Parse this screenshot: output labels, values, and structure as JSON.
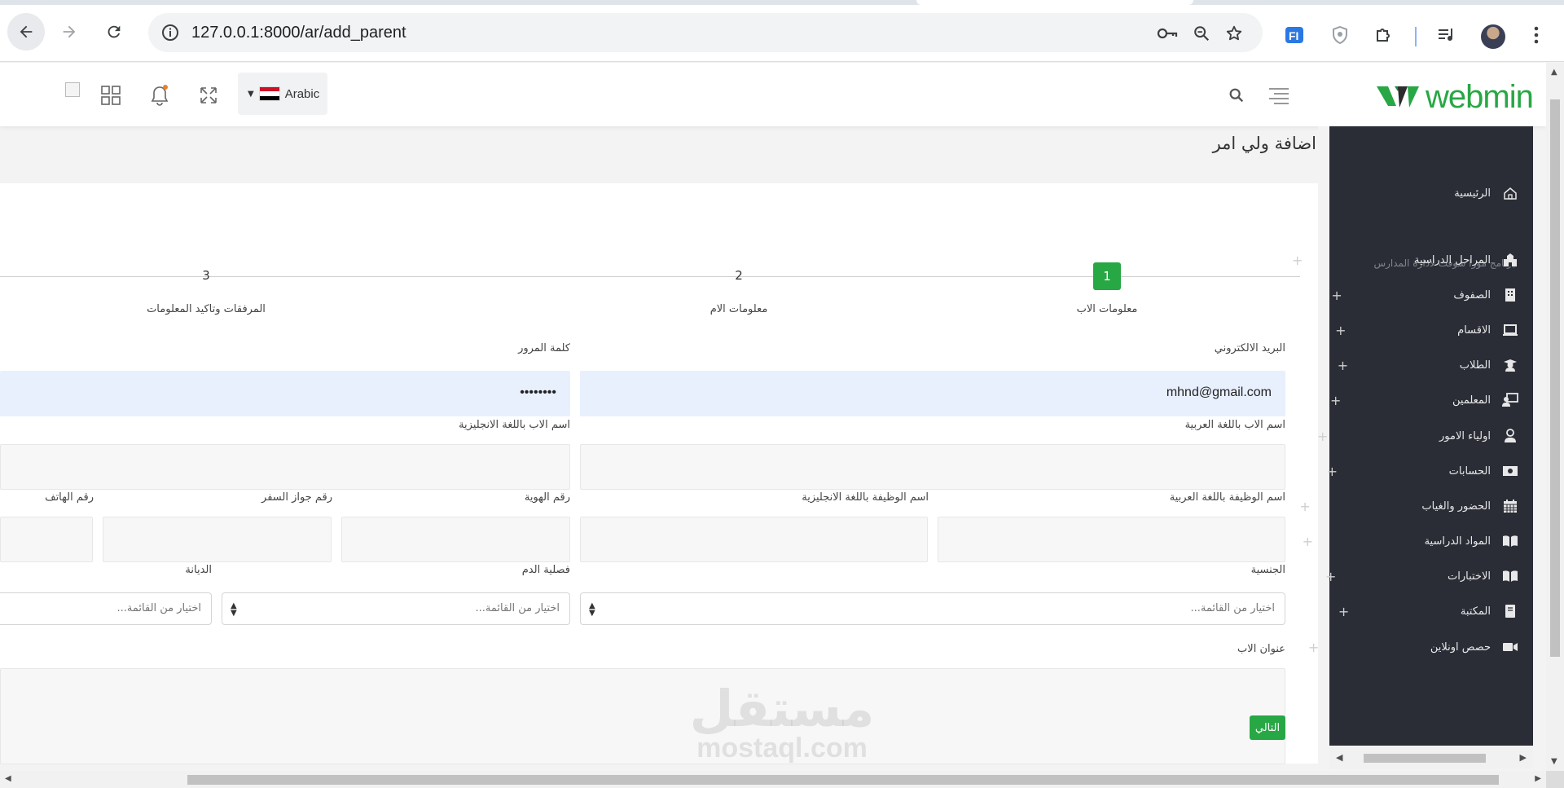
{
  "browser": {
    "url": "127.0.0.1:8000/ar/add_parent"
  },
  "header": {
    "language_label": "Arabic",
    "logo_text": "webmin",
    "flag_colors": [
      "#ce1126",
      "#ffffff",
      "#000000"
    ]
  },
  "sidebar": {
    "caption": "برنامج مورا سوفت لادارة المدارس",
    "items": [
      {
        "label": "الرئيسية",
        "icon": "home-icon"
      },
      {
        "label": "المراحل الدراسية",
        "icon": "school-icon"
      },
      {
        "label": "الصفوف",
        "icon": "building-icon"
      },
      {
        "label": "الاقسام",
        "icon": "laptop-icon"
      },
      {
        "label": "الطلاب",
        "icon": "graduate-icon"
      },
      {
        "label": "المعلمين",
        "icon": "teacher-icon"
      },
      {
        "label": "اولياء الامور",
        "icon": "user-icon"
      },
      {
        "label": "الحسابات",
        "icon": "money-icon"
      },
      {
        "label": "الحضور والغياب",
        "icon": "calendar-icon"
      },
      {
        "label": "المواد الدراسية",
        "icon": "book-open-icon"
      },
      {
        "label": "الاختبارات",
        "icon": "book-open-icon"
      },
      {
        "label": "المكتبة",
        "icon": "book-icon"
      },
      {
        "label": "حصص اونلاين",
        "icon": "video-icon"
      }
    ]
  },
  "page": {
    "title": "اضافة ولي امر"
  },
  "steps": [
    {
      "number": "1",
      "label": "معلومات الاب"
    },
    {
      "number": "2",
      "label": "معلومات الام"
    },
    {
      "number": "3",
      "label": "المرفقات وتاكيد المعلومات"
    }
  ],
  "form": {
    "email_label": "البريد الالكتروني",
    "email_value": "mhnd@gmail.com",
    "password_label": "كلمة المرور",
    "password_value": "••••••••",
    "name_ar_label": "اسم الاب باللغة العربية",
    "name_en_label": "اسم الاب باللغة الانجليزية",
    "job_ar_label": "اسم الوظيفة باللغة العربية",
    "job_en_label": "اسم الوظيفة باللغة الانجليزية",
    "id_label": "رقم الهوية",
    "passport_label": "رقم جواز السفر",
    "phone_label": "رقم الهاتف",
    "nationality_label": "الجنسية",
    "blood_label": "فصلية الدم",
    "religion_label": "الديانة",
    "select_placeholder": "اختيار من القائمة...",
    "address_label": "عنوان الاب",
    "next_label": "التالي"
  },
  "watermark": {
    "arabic": "مستقل",
    "latin": "mostaql.com"
  }
}
